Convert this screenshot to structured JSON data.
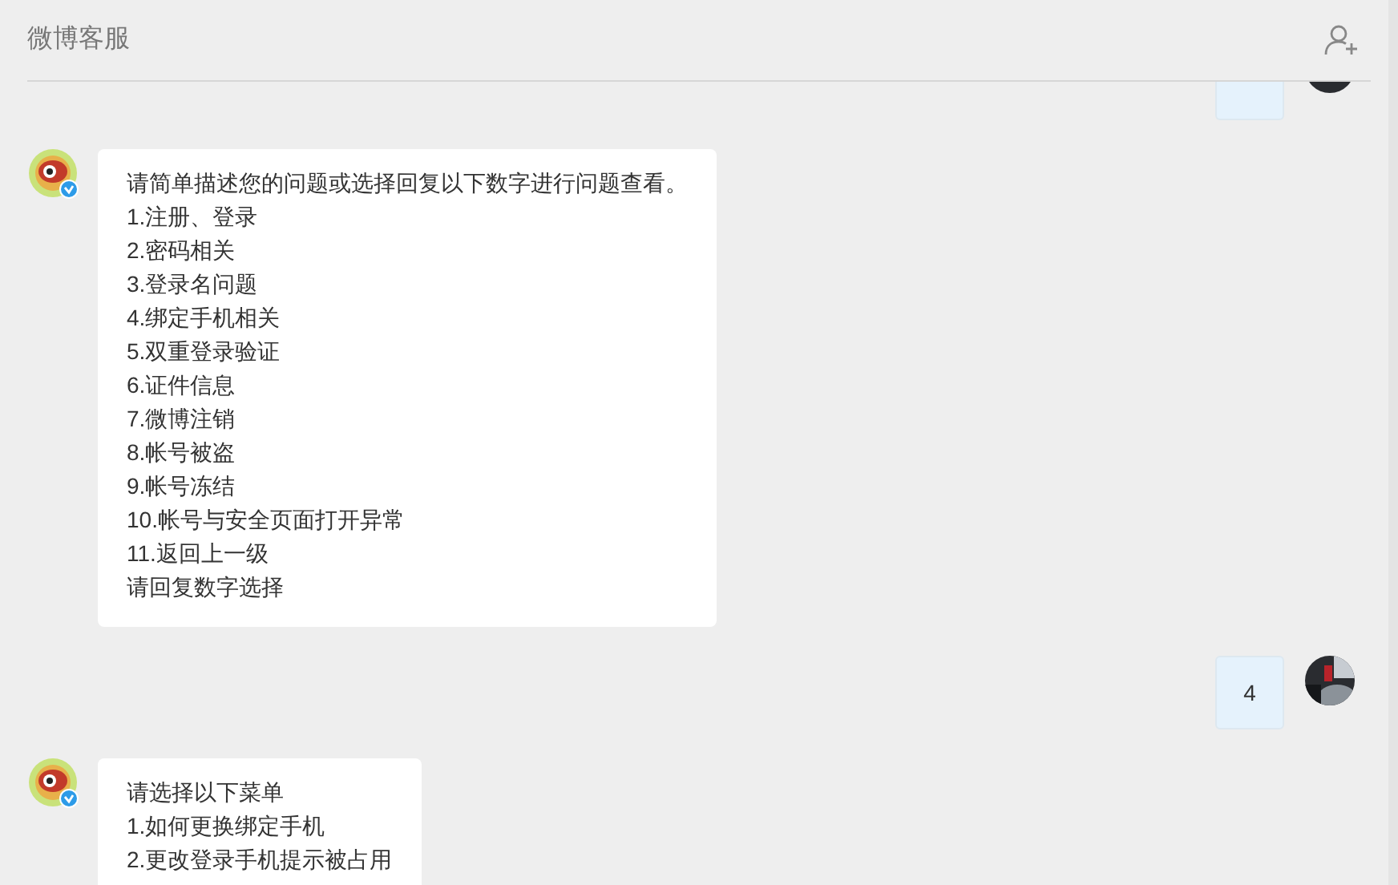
{
  "header": {
    "title": "微博客服"
  },
  "messages": [
    {
      "kind": "clipped"
    },
    {
      "kind": "received",
      "lines": [
        "请简单描述您的问题或选择回复以下数字进行问题查看。",
        "1.注册、登录",
        "2.密码相关",
        "3.登录名问题",
        "4.绑定手机相关",
        "5.双重登录验证",
        "6.证件信息",
        "7.微博注销",
        "8.帐号被盗",
        "9.帐号冻结",
        "10.帐号与安全页面打开异常",
        "11.返回上一级",
        "请回复数字选择"
      ]
    },
    {
      "kind": "sent",
      "lines": [
        "4"
      ]
    },
    {
      "kind": "received",
      "lines": [
        "请选择以下菜单",
        "1.如何更换绑定手机",
        "2.更改登录手机提示被占用"
      ]
    }
  ]
}
